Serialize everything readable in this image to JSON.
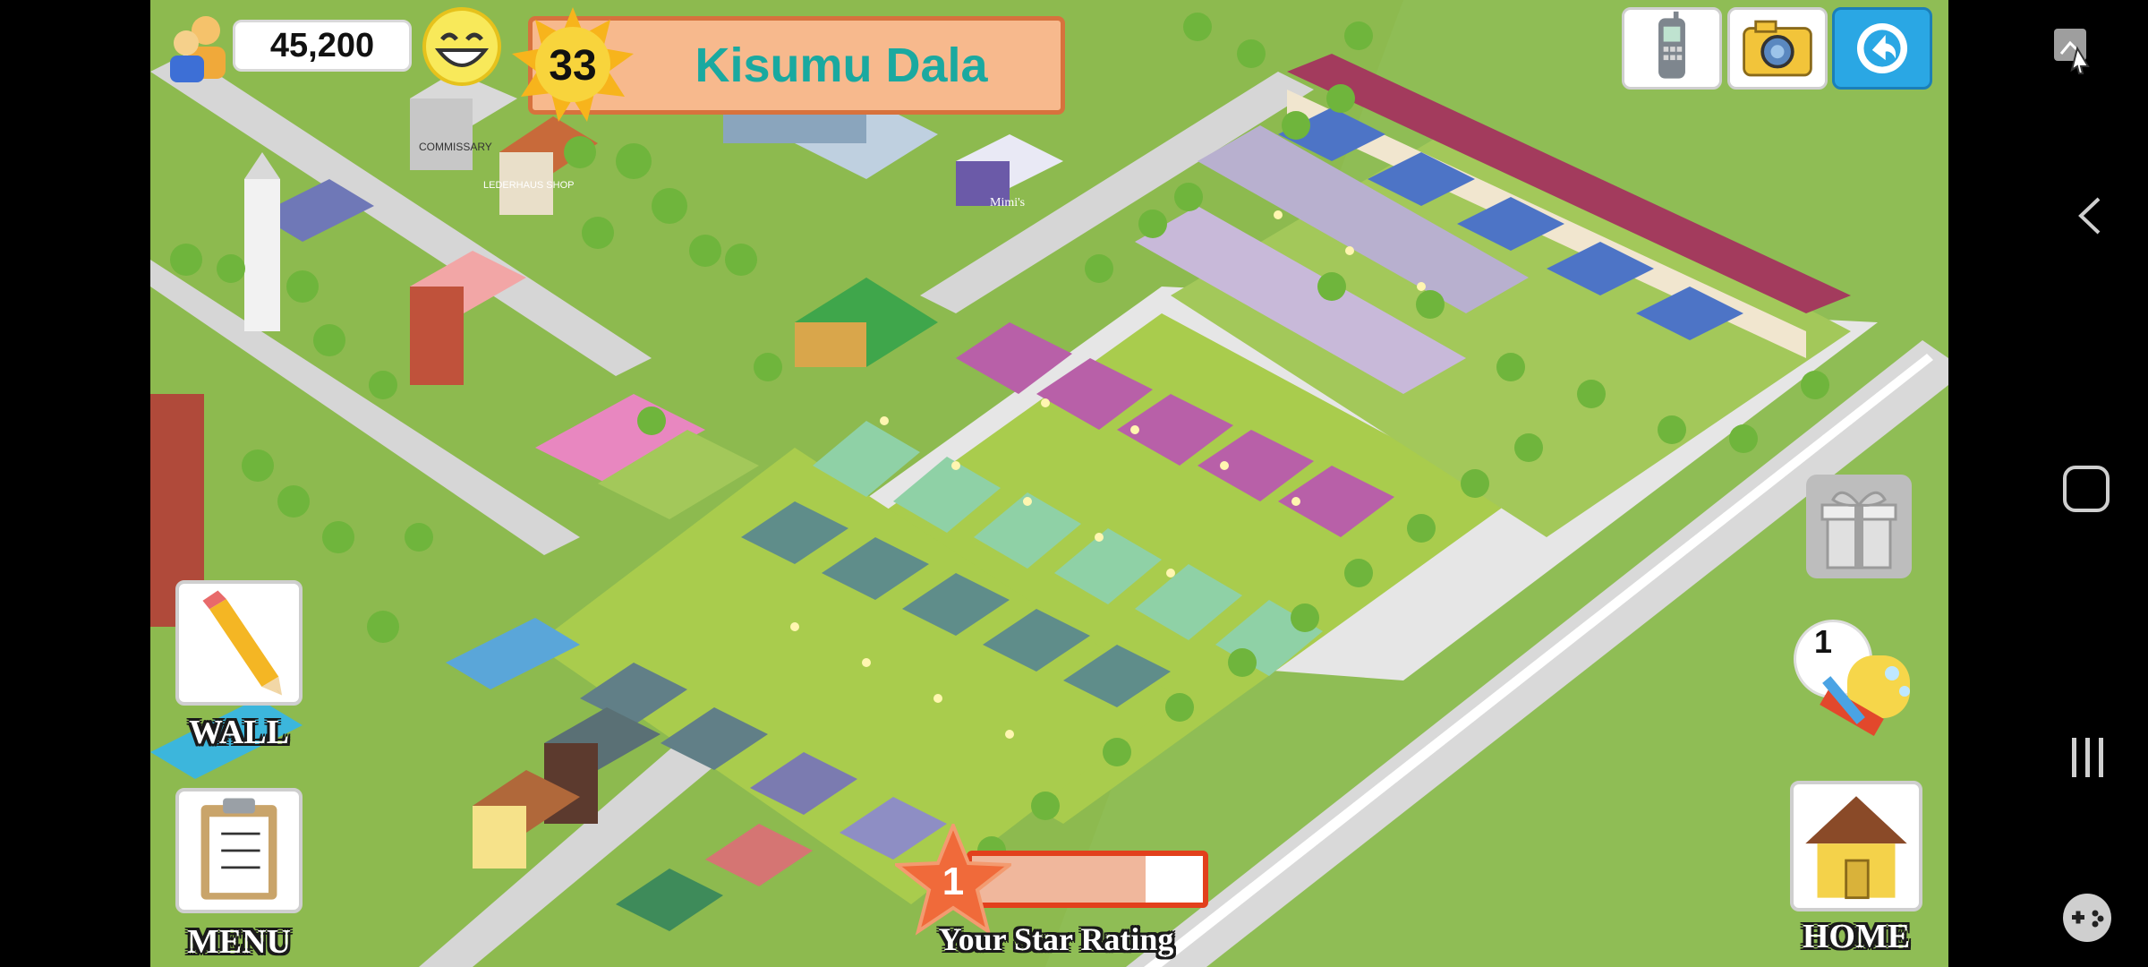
{
  "hud": {
    "coins": "45,200",
    "level": "33",
    "player_name": "Kisumu Dala"
  },
  "top_buttons": [
    "phone-icon",
    "camera-icon",
    "share-icon"
  ],
  "left_buttons": {
    "wall_label": "WALL",
    "menu_label": "MENU"
  },
  "right_buttons": {
    "gift_label": "",
    "cleanup_count": "1",
    "home_label": "HOME"
  },
  "star_rating": {
    "value": "1",
    "progress": 0.75,
    "caption": "Your Star Rating"
  },
  "signs": {
    "commissary": "COMMISSARY",
    "leather_shop": "LEDERHAUS SHOP",
    "mimis": "Mimi's"
  },
  "colors": {
    "grass": "#8dba4f",
    "road": "#c9c9c9",
    "accent_orange": "#f7b98d",
    "name_teal": "#1aa9a0"
  }
}
